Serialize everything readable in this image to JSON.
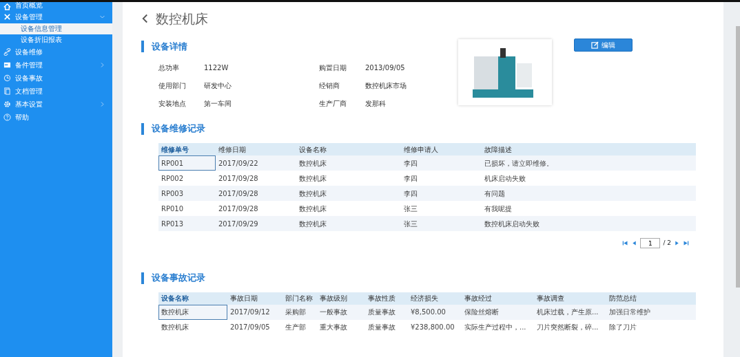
{
  "sidebar": {
    "items": [
      {
        "label": "首页概览",
        "has_children": false
      },
      {
        "label": "设备管理",
        "expanded": true,
        "has_children": true,
        "children": [
          {
            "label": "设备信息管理",
            "selected": true
          },
          {
            "label": "设备折旧报表",
            "selected": false
          }
        ]
      },
      {
        "label": "设备维修",
        "has_children": false
      },
      {
        "label": "备件管理",
        "expanded": false,
        "has_children": true
      },
      {
        "label": "设备事故",
        "has_children": false
      },
      {
        "label": "文档管理",
        "has_children": false
      },
      {
        "label": "基本设置",
        "expanded": false,
        "has_children": true
      },
      {
        "label": "帮助",
        "has_children": false
      }
    ]
  },
  "page": {
    "title": "数控机床"
  },
  "details": {
    "heading": "设备详情",
    "edit_button": "编辑",
    "fields": [
      {
        "label": "总功率",
        "value": "1122W"
      },
      {
        "label": "购置日期",
        "value": "2013/09/05"
      },
      {
        "label": "使用部门",
        "value": "研发中心"
      },
      {
        "label": "经销商",
        "value": "数控机床市场"
      },
      {
        "label": "安装地点",
        "value": "第一车间"
      },
      {
        "label": "生产厂商",
        "value": "发那科"
      }
    ]
  },
  "repairs": {
    "heading": "设备维修记录",
    "columns": [
      "维修单号",
      "维修日期",
      "设备名称",
      "维修申请人",
      "故障描述"
    ],
    "rows": [
      {
        "selected": true,
        "cells": [
          "RP001",
          "2017/09/22",
          "数控机床",
          "李四",
          "已损坏，请立即维修。"
        ]
      },
      {
        "selected": false,
        "cells": [
          "RP002",
          "2017/09/28",
          "数控机床",
          "李四",
          "机床启动失败"
        ]
      },
      {
        "selected": false,
        "cells": [
          "RP003",
          "2017/09/28",
          "数控机床",
          "李四",
          "有问题"
        ]
      },
      {
        "selected": false,
        "cells": [
          "RP010",
          "2017/09/28",
          "数控机床",
          "张三",
          "有我呢提"
        ]
      },
      {
        "selected": false,
        "cells": [
          "RP013",
          "2017/09/29",
          "数控机床",
          "张三",
          "数控机床启动失败"
        ]
      }
    ],
    "pagination": {
      "page": "1",
      "total": "/ 2"
    }
  },
  "accidents": {
    "heading": "设备事故记录",
    "columns": [
      "设备名称",
      "事故日期",
      "部门名称",
      "事故级别",
      "事故性质",
      "经济损失",
      "事故经过",
      "事故调查",
      "防范总结"
    ],
    "rows": [
      {
        "selected": true,
        "cells": [
          "数控机床",
          "2017/09/12",
          "采购部",
          "一般事故",
          "质量事故",
          "¥8,500.00",
          "保险丝熔断",
          "机床过载，产生原...",
          "加强日常维护"
        ]
      },
      {
        "selected": false,
        "cells": [
          "数控机床",
          "2017/09/05",
          "生产部",
          "重大事故",
          "质量事故",
          "¥238,800.00",
          "实际生产过程中，...",
          "刀片突然断裂，碎...",
          "除了刀片"
        ]
      }
    ]
  }
}
